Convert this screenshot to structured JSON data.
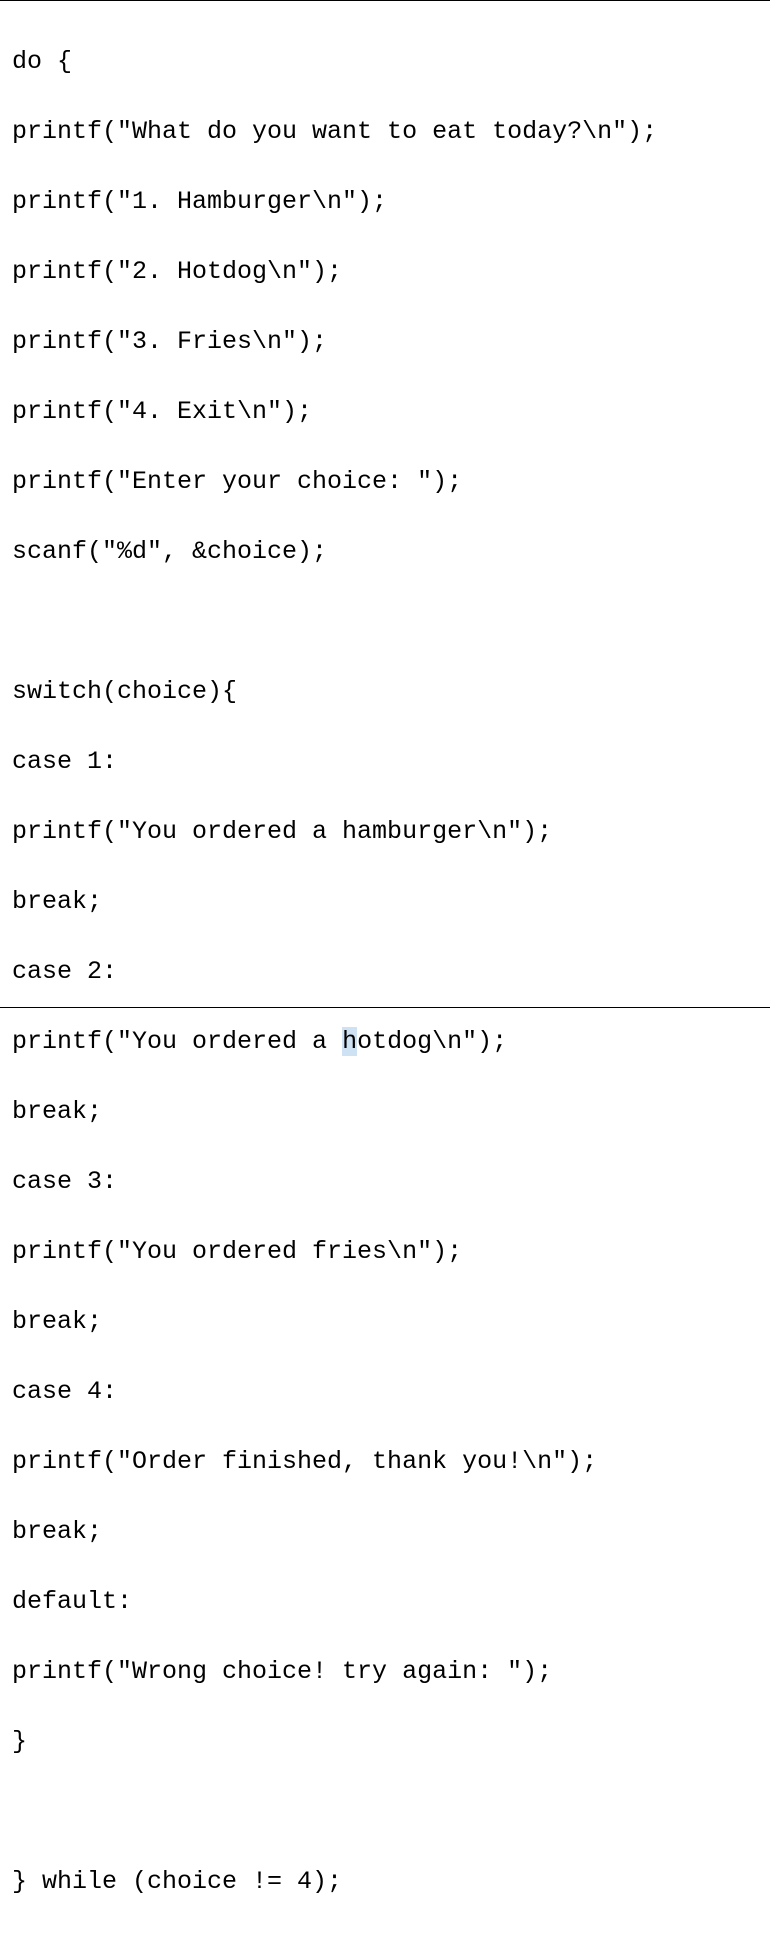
{
  "code": {
    "line1": "do {",
    "line2": "printf(\"What do you want to eat today?\\n\");",
    "line3": "printf(\"1. Hamburger\\n\");",
    "line4": "printf(\"2. Hotdog\\n\");",
    "line5": "printf(\"3. Fries\\n\");",
    "line6": "printf(\"4. Exit\\n\");",
    "line7": "printf(\"Enter your choice: \");",
    "line8": "scanf(\"%d\", &choice);",
    "line9": "",
    "line10": "switch(choice){",
    "line11": "case 1:",
    "line12": "printf(\"You ordered a hamburger\\n\");",
    "line13": "break;",
    "line14": "case 2:",
    "line15_prefix": "printf(\"You ordered a ",
    "line15_highlight": "h",
    "line15_suffix": "otdog\\n\");",
    "line16": "break;",
    "line17": "case 3:",
    "line18": "printf(\"You ordered fries\\n\");",
    "line19": "break;",
    "line20": "case 4:",
    "line21": "printf(\"Order finished, thank you!\\n\");",
    "line22": "break;",
    "line23": "default:",
    "line24": "printf(\"Wrong choice! try again: \");",
    "line25": "}",
    "line26": "",
    "line27": "} while (choice != 4);"
  }
}
